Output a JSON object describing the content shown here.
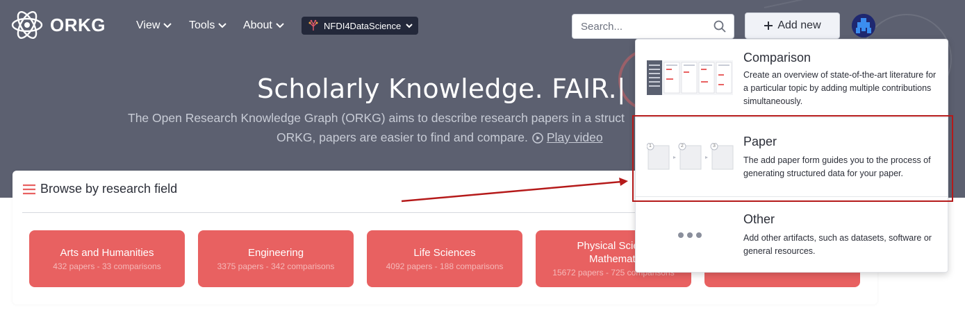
{
  "brand": {
    "name": "ORKG"
  },
  "nav": {
    "items": [
      {
        "label": "View"
      },
      {
        "label": "Tools"
      },
      {
        "label": "About"
      }
    ],
    "observatory": "NFDI4DataScience"
  },
  "search": {
    "placeholder": "Search..."
  },
  "add_new": {
    "label": "Add new"
  },
  "hero": {
    "title": "Scholarly Knowledge. FAIR.|",
    "subtitle_line1": "The Open Research Knowledge Graph (ORKG) aims to describe research papers in a struct",
    "subtitle_line2": "ORKG, papers are easier to find and compare.",
    "play_video": "Play video"
  },
  "browse": {
    "title": "Browse by research field",
    "fields": [
      {
        "name": "Arts and Humanities",
        "stats": "432 papers - 33 comparisons"
      },
      {
        "name": "Engineering",
        "stats": "3375 papers - 342 comparisons"
      },
      {
        "name": "Life Sciences",
        "stats": "4092 papers - 188 comparisons"
      },
      {
        "name": "Physical Scienc",
        "name2": "Mathemati",
        "stats": "15672 papers - 725 comparisons"
      },
      {
        "name": "",
        "stats": ""
      }
    ]
  },
  "dropdown": {
    "items": [
      {
        "title": "Comparison",
        "description": "Create an overview of state-of-the-art literature for a particular topic by adding multiple contributions simultaneously."
      },
      {
        "title": "Paper",
        "description": "The add paper form guides you to the process of generating structured data for your paper.",
        "steps": [
          "1",
          "2",
          "3"
        ]
      },
      {
        "title": "Other",
        "description": "Add other artifacts, such as datasets, software or general resources."
      }
    ]
  },
  "colors": {
    "accent": "#e86161",
    "hero_bg": "#5c6070",
    "highlight": "#b51a1a"
  }
}
